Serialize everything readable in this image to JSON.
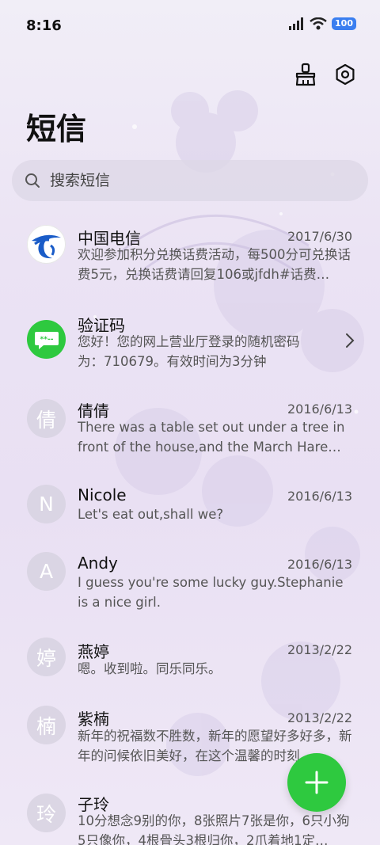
{
  "status": {
    "time": "8:16",
    "battery": "100"
  },
  "header": {
    "title": "短信"
  },
  "search": {
    "placeholder": "搜索短信"
  },
  "messages": [
    {
      "avatar": "",
      "name": "中国电信",
      "date": "2017/6/30",
      "preview": "欢迎参加积分兑换话费活动，每500分可兑换话费5元，兑换话费请回复106或jfdh#话费…"
    },
    {
      "avatar": "",
      "name": "验证码",
      "date": "",
      "preview": "您好！您的网上营业厅登录的随机密码为：710679。有效时间为3分钟"
    },
    {
      "avatar": "倩",
      "name": "倩倩",
      "date": "2016/6/13",
      "preview": "There was a table set out under a tree in front of the house,and the March Hare an…"
    },
    {
      "avatar": "N",
      "name": "Nicole",
      "date": "2016/6/13",
      "preview": "Let's eat out,shall we?"
    },
    {
      "avatar": "A",
      "name": "Andy",
      "date": "2016/6/13",
      "preview": "I guess you're some lucky guy.Stephanie is a nice girl."
    },
    {
      "avatar": "婷",
      "name": "燕婷",
      "date": "2013/2/22",
      "preview": "嗯。收到啦。同乐同乐。"
    },
    {
      "avatar": "楠",
      "name": "紫楠",
      "date": "2013/2/22",
      "preview": "新年的祝福数不胜数，新年的愿望好多好多，新年的问候依旧美好，在这个温馨的时刻…"
    },
    {
      "avatar": "玲",
      "name": "子玲",
      "date": "2013/2/22",
      "preview": "10分想念9别的你，8张照片7张是你，6只小狗5只像你，4根骨头3根归你，2爪着地1定…"
    }
  ],
  "icons": {
    "broom": "broom-icon",
    "settings": "settings-icon",
    "search": "search-icon",
    "fab": "plus-icon"
  },
  "colors": {
    "accent": "#2ec93f",
    "telecom": "#1a5cc8"
  }
}
